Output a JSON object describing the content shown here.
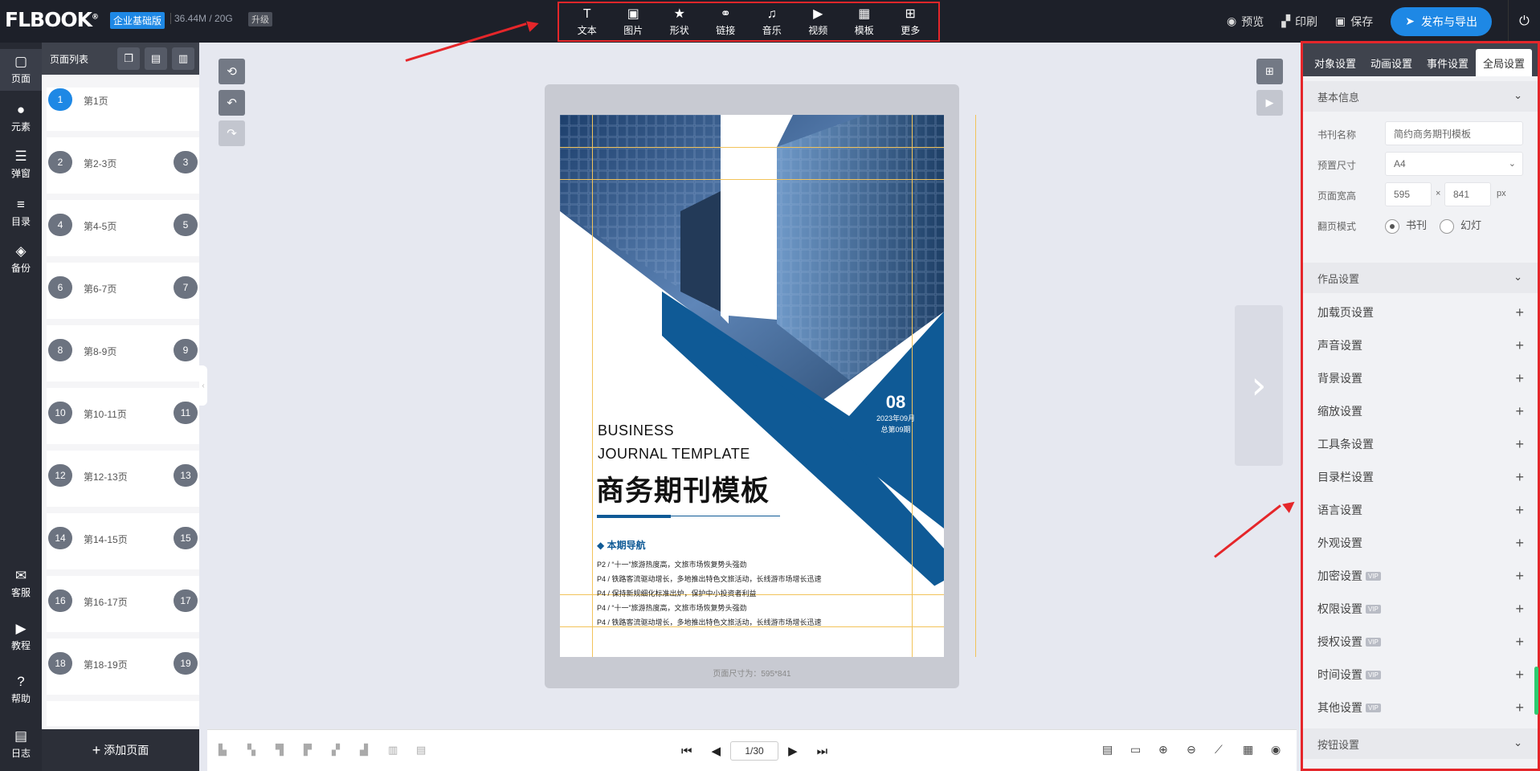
{
  "app": {
    "logo": "FLBOOK",
    "edition": "企业基础版",
    "storage": "36.44M / 20G",
    "upgrade": "升级"
  },
  "toolbar": {
    "items": [
      {
        "label": "文本",
        "icon": "text-icon",
        "glyph": "T"
      },
      {
        "label": "图片",
        "icon": "image-icon",
        "glyph": "▣"
      },
      {
        "label": "形状",
        "icon": "star-icon",
        "glyph": "★"
      },
      {
        "label": "链接",
        "icon": "link-icon",
        "glyph": "⚭"
      },
      {
        "label": "音乐",
        "icon": "music-icon",
        "glyph": "♫"
      },
      {
        "label": "视频",
        "icon": "play-circle-icon",
        "glyph": "▶"
      },
      {
        "label": "模板",
        "icon": "template-icon",
        "glyph": "▦"
      },
      {
        "label": "更多",
        "icon": "more-icon",
        "glyph": "⊞"
      }
    ]
  },
  "top_actions": {
    "preview": "预览",
    "print": "印刷",
    "save": "保存",
    "publish": "发布与导出"
  },
  "leftnav": {
    "top": [
      {
        "label": "页面",
        "icon": "page-icon",
        "glyph": "▢"
      },
      {
        "label": "元素",
        "icon": "elements-icon",
        "glyph": "●"
      },
      {
        "label": "弹窗",
        "icon": "popup-icon",
        "glyph": "☰"
      },
      {
        "label": "目录",
        "icon": "toc-icon",
        "glyph": "≡"
      },
      {
        "label": "备份",
        "icon": "layers-icon",
        "glyph": "◈"
      }
    ],
    "bottom": [
      {
        "label": "客服",
        "icon": "chat-icon",
        "glyph": "✉"
      },
      {
        "label": "教程",
        "icon": "tutorial-icon",
        "glyph": "▶"
      },
      {
        "label": "帮助",
        "icon": "help-icon",
        "glyph": "?"
      },
      {
        "label": "日志",
        "icon": "log-icon",
        "glyph": "▤"
      }
    ]
  },
  "pagelist": {
    "title": "页面列表",
    "add_page": "添加页面",
    "items": [
      {
        "label": "第1页",
        "left": "1",
        "right": ""
      },
      {
        "label": "第2-3页",
        "left": "2",
        "right": "3"
      },
      {
        "label": "第4-5页",
        "left": "4",
        "right": "5"
      },
      {
        "label": "第6-7页",
        "left": "6",
        "right": "7"
      },
      {
        "label": "第8-9页",
        "left": "8",
        "right": "9"
      },
      {
        "label": "第10-11页",
        "left": "10",
        "right": "11"
      },
      {
        "label": "第12-13页",
        "left": "12",
        "right": "13"
      },
      {
        "label": "第14-15页",
        "left": "14",
        "right": "15"
      },
      {
        "label": "第16-17页",
        "left": "16",
        "right": "17"
      },
      {
        "label": "第18-19页",
        "left": "18",
        "right": "19"
      }
    ]
  },
  "cover": {
    "issue_no": "08",
    "date": "2023年09月",
    "issue_total": "总第09期",
    "en_title_1": "BUSINESS",
    "en_title_2": "JOURNAL TEMPLATE",
    "cn_title": "商务期刊模板",
    "nav_title": "◆ 本期导航",
    "nav_lines": [
      "P2 / “十一”旅游热度高，文旅市场恢复势头强劲",
      "P4 / 铁路客流驱动增长，多地推出特色文旅活动，长线游市场增长迅速",
      "P4 / 保持新规细化标准出炉，保护中小投资者利益",
      "P4 / “十一”旅游热度高，文旅市场恢复势头强劲",
      "P4 / 铁路客流驱动增长，多地推出特色文旅活动，长线游市场增长迅速"
    ]
  },
  "canvas": {
    "page_size": "页面尺寸为：595*841"
  },
  "pager": {
    "value": "1/30"
  },
  "rightpanel": {
    "tabs": [
      "对象设置",
      "动画设置",
      "事件设置",
      "全局设置"
    ],
    "basic_info": "基本信息",
    "book_name_label": "书刊名称",
    "book_name_value": "简约商务期刊模板",
    "preset_size_label": "预置尺寸",
    "preset_size_value": "A4",
    "page_size_label": "页面宽高",
    "width": "595",
    "times": "×",
    "height": "841",
    "px": "px",
    "flip_mode_label": "翻页模式",
    "flip_book": "书刊",
    "flip_slide": "幻灯",
    "work_settings": "作品设置",
    "items": [
      {
        "label": "加载页设置",
        "vip": ""
      },
      {
        "label": "声音设置",
        "vip": ""
      },
      {
        "label": "背景设置",
        "vip": ""
      },
      {
        "label": "缩放设置",
        "vip": ""
      },
      {
        "label": "工具条设置",
        "vip": ""
      },
      {
        "label": "目录栏设置",
        "vip": ""
      },
      {
        "label": "语言设置",
        "vip": ""
      },
      {
        "label": "外观设置",
        "vip": ""
      },
      {
        "label": "加密设置",
        "vip": "VIP"
      },
      {
        "label": "权限设置",
        "vip": "VIP"
      },
      {
        "label": "授权设置",
        "vip": "VIP"
      },
      {
        "label": "时间设置",
        "vip": "VIP"
      },
      {
        "label": "其他设置",
        "vip": "VIP"
      }
    ],
    "button_settings": "按钮设置"
  },
  "colors": {
    "accent": "#1e88e5",
    "cover_blue": "#0f5a96",
    "annotation_red": "#e5262a"
  }
}
